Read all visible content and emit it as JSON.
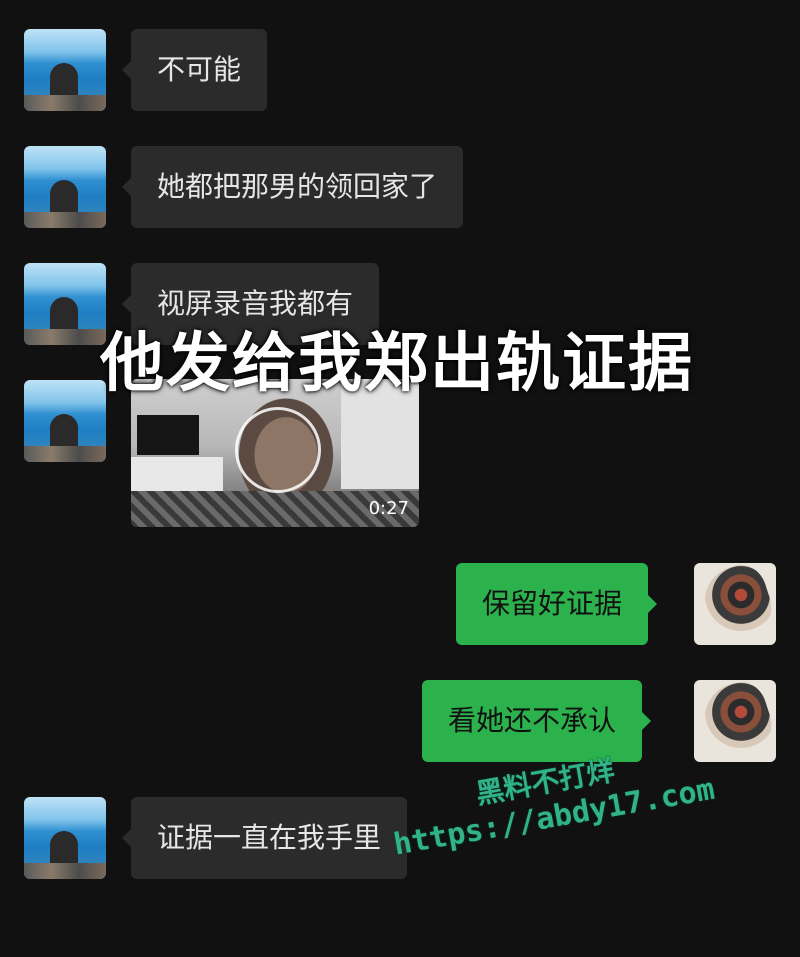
{
  "messages": [
    {
      "side": "left",
      "text": "不可能"
    },
    {
      "side": "left",
      "text": "她都把那男的领回家了"
    },
    {
      "side": "left",
      "text": "视屏录音我都有"
    },
    {
      "side": "left",
      "type": "video",
      "duration": "0:27"
    },
    {
      "side": "right",
      "text": "保留好证据"
    },
    {
      "side": "right",
      "text": "看她还不承认"
    },
    {
      "side": "left",
      "text": "证据一直在我手里"
    }
  ],
  "overlay_caption": "他发给我郑出轨证据",
  "watermark": {
    "name": "黑料不打烊",
    "url": "https://abdy17.com"
  }
}
